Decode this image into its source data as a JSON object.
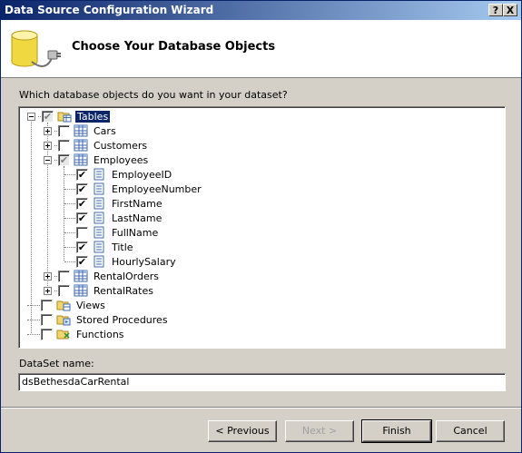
{
  "window": {
    "title": "Data Source Configuration Wizard",
    "help_label": "?",
    "close_label": "X"
  },
  "header": {
    "heading": "Choose Your Database Objects"
  },
  "prompt": "Which database objects do you want in your dataset?",
  "tree": {
    "tables_label": "Tables",
    "cars_label": "Cars",
    "customers_label": "Customers",
    "employees_label": "Employees",
    "columns": [
      {
        "label": "EmployeeID",
        "checked": true
      },
      {
        "label": "EmployeeNumber",
        "checked": true
      },
      {
        "label": "FirstName",
        "checked": true
      },
      {
        "label": "LastName",
        "checked": true
      },
      {
        "label": "FullName",
        "checked": false
      },
      {
        "label": "Title",
        "checked": true
      },
      {
        "label": "HourlySalary",
        "checked": true
      }
    ],
    "rentalorders_label": "RentalOrders",
    "rentalrates_label": "RentalRates",
    "views_label": "Views",
    "procedures_label": "Stored Procedures",
    "functions_label": "Functions"
  },
  "dataset": {
    "label": "DataSet name:",
    "value": "dsBethesdaCarRental"
  },
  "buttons": {
    "previous": "< Previous",
    "next": "Next >",
    "finish": "Finish",
    "cancel": "Cancel"
  },
  "check_mark": "✔"
}
